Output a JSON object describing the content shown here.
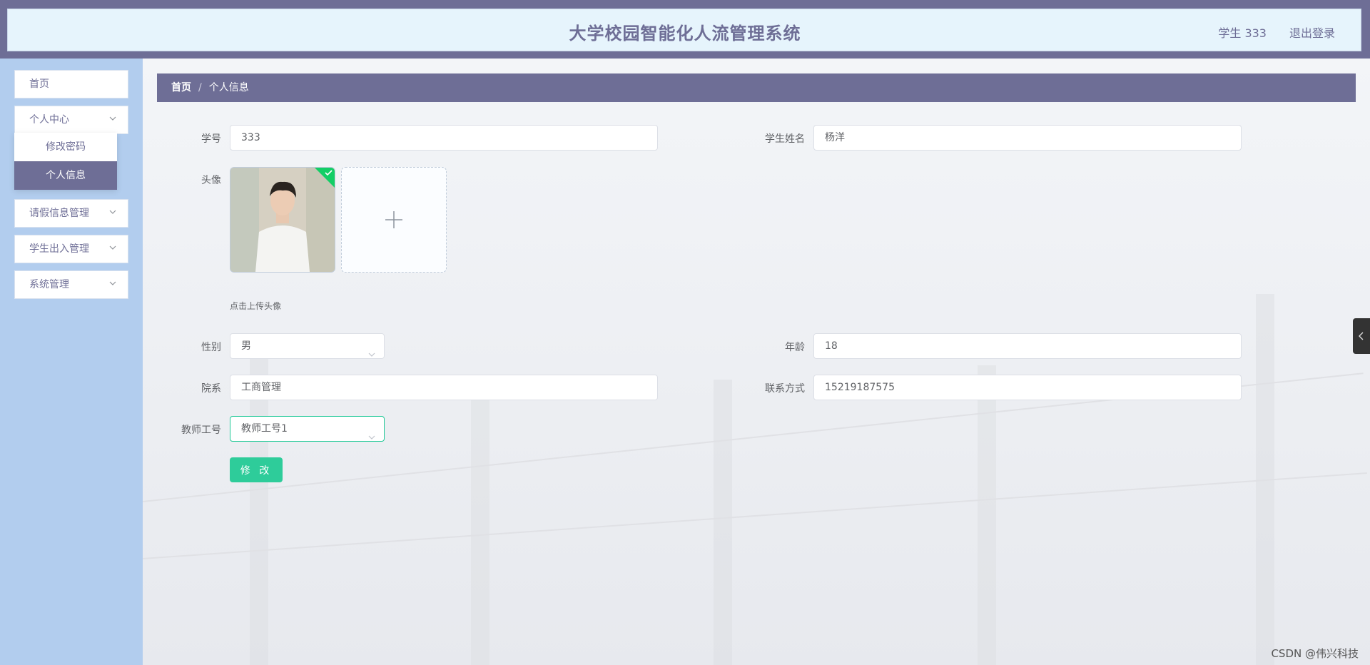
{
  "header": {
    "title": "大学校园智能化人流管理系统",
    "user": "学生 333",
    "logout": "退出登录"
  },
  "sidebar": {
    "items": [
      {
        "label": "首页"
      },
      {
        "label": "个人中心"
      },
      {
        "label": "请假信息管理"
      },
      {
        "label": "学生出入管理"
      },
      {
        "label": "系统管理"
      }
    ],
    "submenu": [
      {
        "label": "修改密码"
      },
      {
        "label": "个人信息"
      }
    ]
  },
  "breadcrumb": {
    "home": "首页",
    "separator": "/",
    "current": "个人信息"
  },
  "form": {
    "student_id": {
      "label": "学号",
      "value": "333"
    },
    "student_name": {
      "label": "学生姓名",
      "value": "杨洋"
    },
    "avatar": {
      "label": "头像",
      "tip": "点击上传头像"
    },
    "gender": {
      "label": "性别",
      "value": "男"
    },
    "age": {
      "label": "年龄",
      "value": "18"
    },
    "department": {
      "label": "院系",
      "value": "工商管理"
    },
    "contact": {
      "label": "联系方式",
      "value": "15219187575"
    },
    "teacher_id": {
      "label": "教师工号",
      "value": "教师工号1"
    },
    "submit": "修 改"
  },
  "watermark": "CSDN @伟兴科技",
  "colors": {
    "accent": "#6e6e96",
    "button": "#2ecc9a",
    "sidebar": "#b2cdee"
  }
}
